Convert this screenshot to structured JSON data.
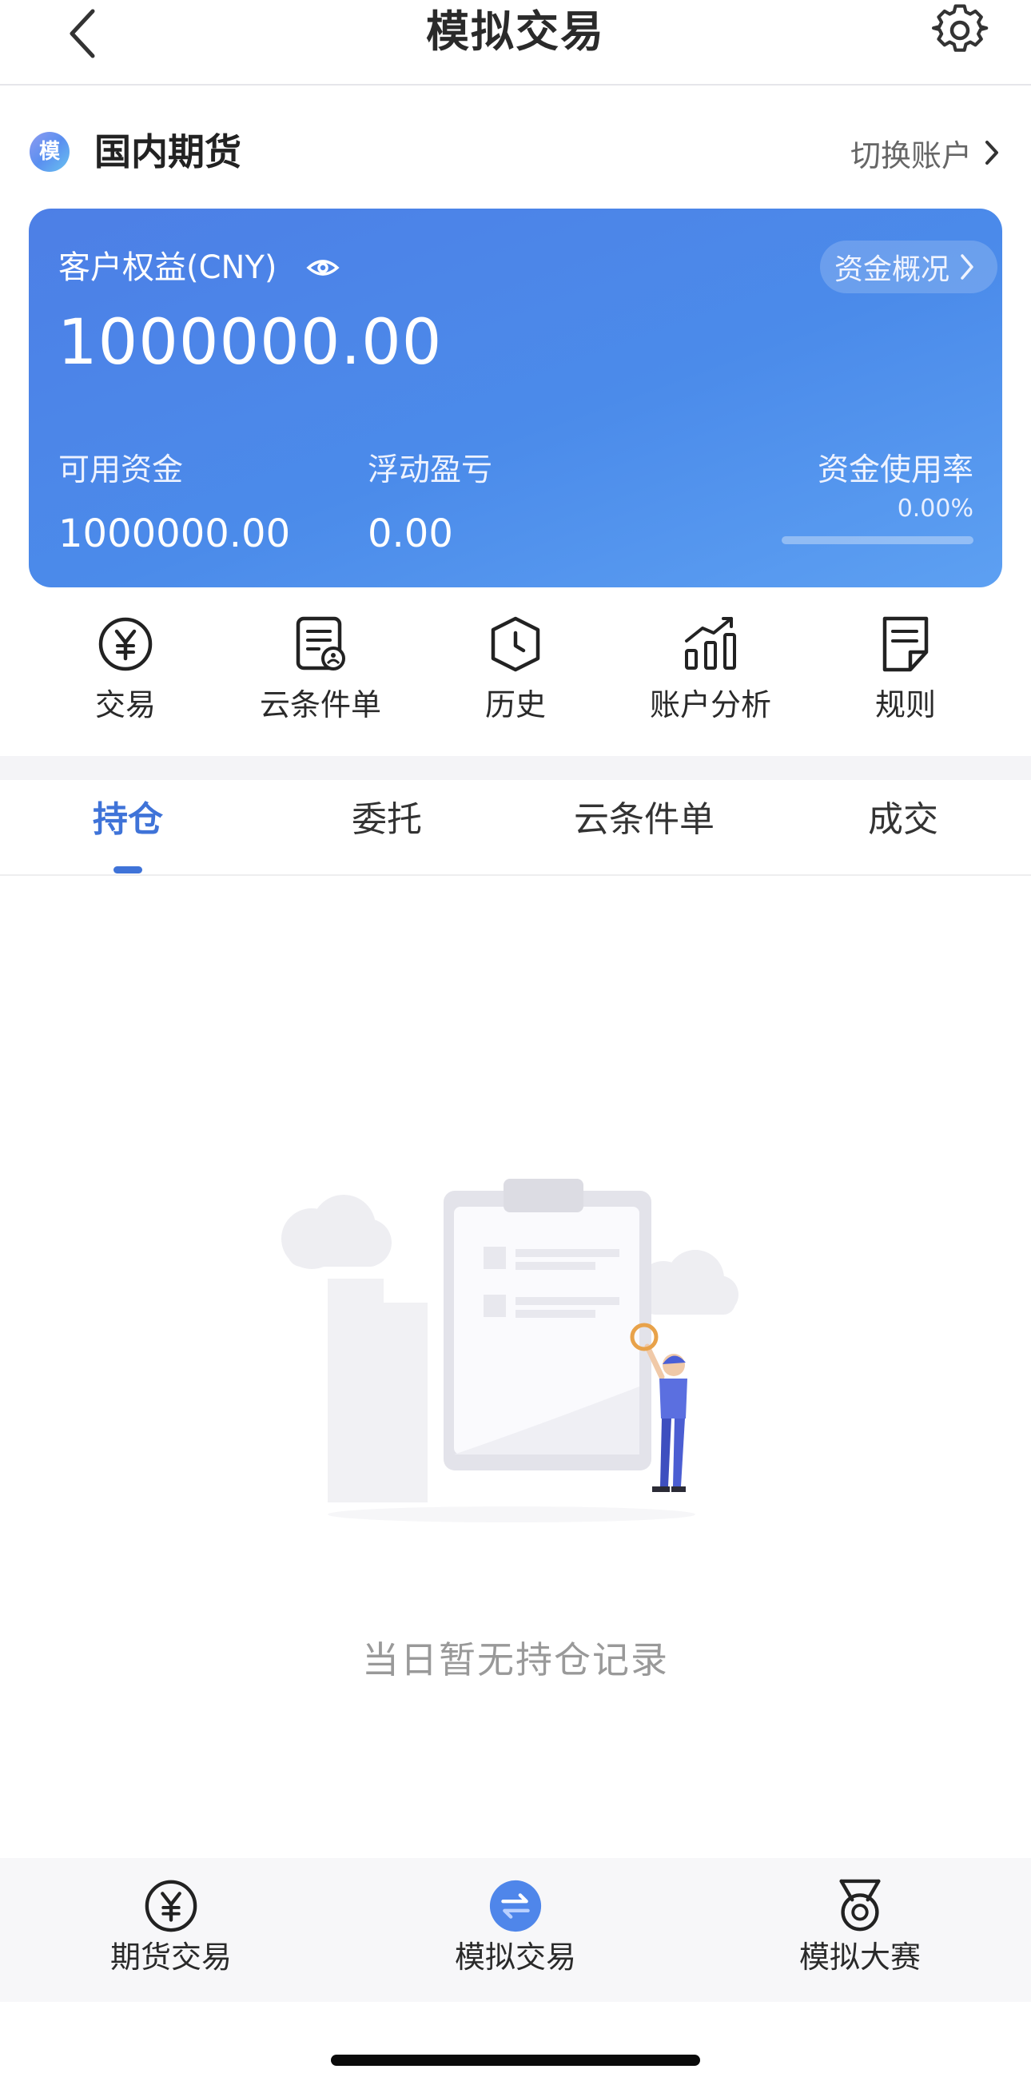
{
  "header": {
    "title": "模拟交易",
    "back_icon": "chevron-left-icon",
    "settings_icon": "gear-icon"
  },
  "account": {
    "badge": "模",
    "name": "国内期货",
    "switch_label": "切换账户"
  },
  "card": {
    "equity_label": "客户权益(CNY)",
    "equity_value": "1000000.00",
    "funds_overview_label": "资金概况",
    "available_label": "可用资金",
    "available_value": "1000000.00",
    "floating_pnl_label": "浮动盈亏",
    "floating_pnl_value": "0.00",
    "usage_label": "资金使用率",
    "usage_value": "0.00%",
    "usage_fraction": 0,
    "gradient_start": "#4d7fe6",
    "gradient_end": "#5da0f2"
  },
  "actions": [
    {
      "label": "交易",
      "icon": "yen-circle-icon"
    },
    {
      "label": "云条件单",
      "icon": "cloud-order-icon"
    },
    {
      "label": "历史",
      "icon": "history-shield-icon"
    },
    {
      "label": "账户分析",
      "icon": "bar-chart-icon"
    },
    {
      "label": "规则",
      "icon": "rules-doc-icon"
    }
  ],
  "tabs": [
    {
      "label": "持仓",
      "active": true
    },
    {
      "label": "委托",
      "active": false
    },
    {
      "label": "云条件单",
      "active": false
    },
    {
      "label": "成交",
      "active": false
    }
  ],
  "empty_state": {
    "text": "当日暂无持仓记录",
    "illustration": "empty-clipboard-illustration"
  },
  "bottom_nav": [
    {
      "label": "期货交易",
      "icon": "yen-circle-icon",
      "active": false
    },
    {
      "label": "模拟交易",
      "icon": "swap-icon",
      "active": true
    },
    {
      "label": "模拟大赛",
      "icon": "medal-icon",
      "active": false
    }
  ],
  "colors": {
    "accent": "#3f73d8",
    "muted_text": "#999999"
  }
}
